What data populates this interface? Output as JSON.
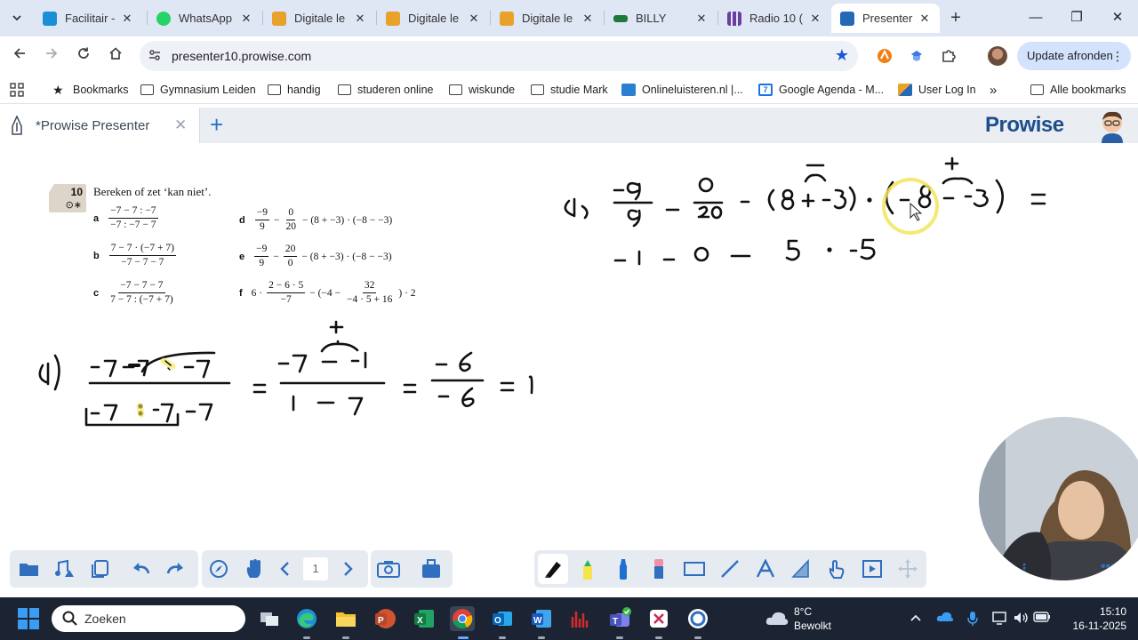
{
  "browser": {
    "tabs": [
      {
        "label": "Facilitair - ",
        "favicon_color": "#1a8fd6",
        "active": false
      },
      {
        "label": "WhatsApp",
        "favicon_color": "#25d366",
        "active": false
      },
      {
        "label": "Digitale le",
        "favicon_color": "#e8a12b",
        "active": false
      },
      {
        "label": "Digitale le",
        "favicon_color": "#e8a12b",
        "active": false
      },
      {
        "label": "Digitale le",
        "favicon_color": "#e8a12b",
        "active": false
      },
      {
        "label": "BILLY",
        "favicon_color": "#1d7a3a",
        "active": false
      },
      {
        "label": "Radio 10 (",
        "favicon_color": "#6b3fa0",
        "active": false
      },
      {
        "label": "Presenter",
        "favicon_color": "#2468b8",
        "active": true
      }
    ],
    "tab_close_glyph": "✕",
    "new_tab_glyph": "+",
    "url": "presenter10.prowise.com",
    "update_button": "Update afronden",
    "window_controls": {
      "minimize": "—",
      "restore": "❐",
      "close": "✕"
    }
  },
  "bookmarks": {
    "items": [
      {
        "label": "Bookmarks",
        "icon": "star-icon"
      },
      {
        "label": "Gymnasium Leiden",
        "icon": "folder-icon"
      },
      {
        "label": "handig",
        "icon": "folder-icon"
      },
      {
        "label": "studeren online",
        "icon": "folder-icon"
      },
      {
        "label": "wiskunde",
        "icon": "folder-icon"
      },
      {
        "label": "studie Mark",
        "icon": "folder-icon"
      },
      {
        "label": "Onlineluisteren.nl |...",
        "icon": "radio-icon"
      },
      {
        "label": "Google Agenda - M...",
        "icon": "calendar-icon"
      },
      {
        "label": "User Log In",
        "icon": "login-icon"
      }
    ],
    "overflow": "»",
    "all_bookmarks": "Alle bookmarks"
  },
  "presenter": {
    "tab_label": "*Prowise Presenter",
    "close_glyph": "✕",
    "add_glyph": "+",
    "logo": {
      "pre": "Pr",
      "mid": "o",
      "post": "wise"
    },
    "page_number": "1"
  },
  "exercise": {
    "number": "10",
    "symbols": "⊙∗",
    "instruction": "Bereken of zet ‘kan niet’.",
    "parts": {
      "a": {
        "label": "a",
        "num": "−7 − 7 : −7",
        "den": "−7 : −7 − 7"
      },
      "b": {
        "label": "b",
        "num": "7 − 7 · (−7 + 7)",
        "den": "−7 − 7 − 7"
      },
      "c": {
        "label": "c",
        "num": "−7 − 7 − 7",
        "den": "7 − 7 : (−7 + 7)"
      },
      "d": {
        "label": "d",
        "f1num": "−9",
        "f1den": "9",
        "op1": "−",
        "f2num": "0",
        "f2den": "20",
        "rest": "− (8 + −3) · (−8 − −3)"
      },
      "e": {
        "label": "e",
        "f1num": "−9",
        "f1den": "9",
        "op1": "−",
        "f2num": "20",
        "f2den": "0",
        "rest": "− (8 + −3) · (−8 − −3)"
      },
      "f": {
        "label": "f",
        "lead": "6 ·",
        "f1num": "2 − 6 · 5",
        "f1den": "−7",
        "mid": "− (−4 −",
        "f2num": "32",
        "f2den": "−4 · 5 + 16",
        "tail": ") · 2"
      }
    }
  },
  "taskbar": {
    "search_placeholder": "Zoeken",
    "weather_temp": "8°C",
    "weather_condition": "Bewolkt",
    "time": "15:10",
    "date": "16-11-2025"
  }
}
